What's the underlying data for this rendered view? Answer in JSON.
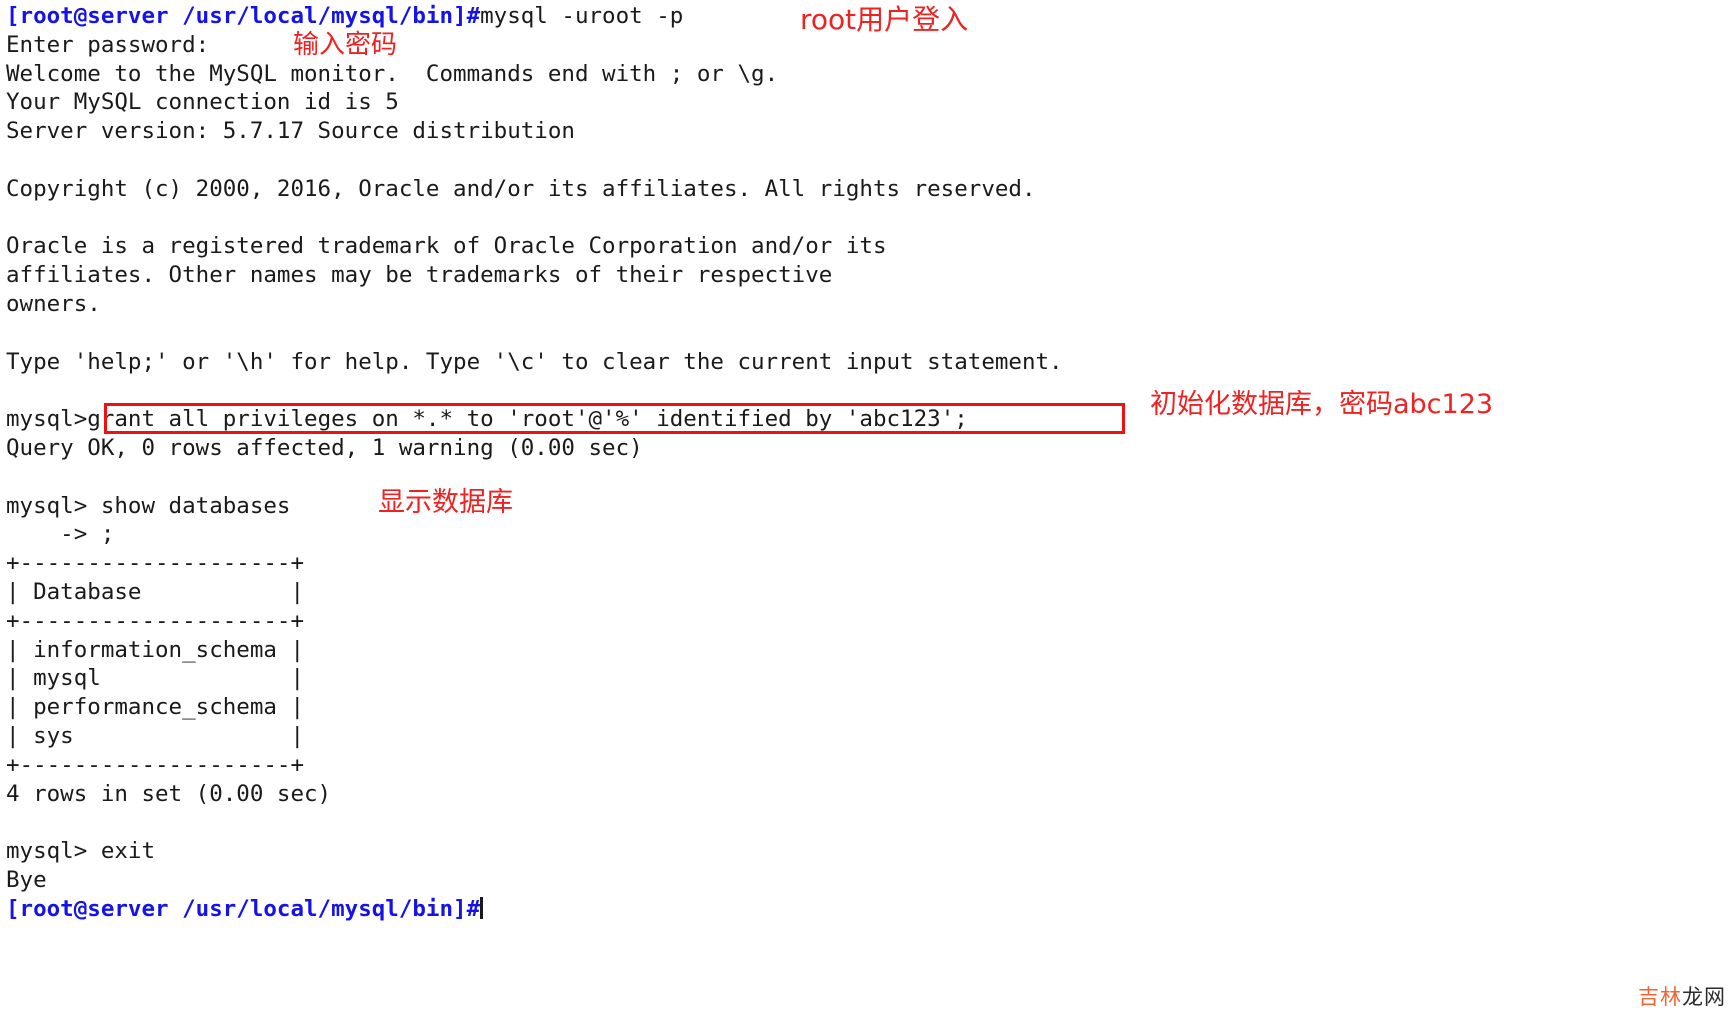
{
  "terminal": {
    "prompt": "[root@server /usr/local/mysql/bin]#",
    "lines": [
      {
        "id": "cmd-mysql-login",
        "type": "prompt",
        "prompt": "[root@server /usr/local/mysql/bin]#",
        "text": "mysql -uroot -p"
      },
      {
        "id": "enter-password",
        "type": "out",
        "text": "Enter password:"
      },
      {
        "id": "welcome",
        "type": "out",
        "text": "Welcome to the MySQL monitor.  Commands end with ; or \\g."
      },
      {
        "id": "connection-id",
        "type": "out",
        "text": "Your MySQL connection id is 5"
      },
      {
        "id": "server-version",
        "type": "out",
        "text": "Server version: 5.7.17 Source distribution"
      },
      {
        "id": "blank-1",
        "type": "blank",
        "text": ""
      },
      {
        "id": "copyright",
        "type": "out",
        "text": "Copyright (c) 2000, 2016, Oracle and/or its affiliates. All rights reserved."
      },
      {
        "id": "blank-2",
        "type": "blank",
        "text": ""
      },
      {
        "id": "trademark-1",
        "type": "out",
        "text": "Oracle is a registered trademark of Oracle Corporation and/or its"
      },
      {
        "id": "trademark-2",
        "type": "out",
        "text": "affiliates. Other names may be trademarks of their respective"
      },
      {
        "id": "trademark-3",
        "type": "out",
        "text": "owners."
      },
      {
        "id": "blank-3",
        "type": "blank",
        "text": ""
      },
      {
        "id": "help-hint",
        "type": "out",
        "text": "Type 'help;' or '\\h' for help. Type '\\c' to clear the current input statement."
      },
      {
        "id": "blank-4",
        "type": "blank",
        "text": ""
      },
      {
        "id": "cmd-grant",
        "type": "mysql",
        "prompt": "mysql>",
        "text": "grant all privileges on *.* to 'root'@'%' identified by 'abc123';"
      },
      {
        "id": "grant-result",
        "type": "out",
        "text": "Query OK, 0 rows affected, 1 warning (0.00 sec)"
      },
      {
        "id": "blank-5",
        "type": "blank",
        "text": ""
      },
      {
        "id": "cmd-show-databases",
        "type": "mysql",
        "prompt": "mysql>",
        "text": " show databases"
      },
      {
        "id": "continuation",
        "type": "out",
        "text": "    -> ;"
      },
      {
        "id": "tbl-top",
        "type": "out",
        "text": "+--------------------+"
      },
      {
        "id": "tbl-header",
        "type": "out",
        "text": "| Database           |"
      },
      {
        "id": "tbl-sep",
        "type": "out",
        "text": "+--------------------+"
      },
      {
        "id": "tbl-row-1",
        "type": "out",
        "text": "| information_schema |"
      },
      {
        "id": "tbl-row-2",
        "type": "out",
        "text": "| mysql              |"
      },
      {
        "id": "tbl-row-3",
        "type": "out",
        "text": "| performance_schema |"
      },
      {
        "id": "tbl-row-4",
        "type": "out",
        "text": "| sys                |"
      },
      {
        "id": "tbl-bottom",
        "type": "out",
        "text": "+--------------------+"
      },
      {
        "id": "rows-in-set",
        "type": "out",
        "text": "4 rows in set (0.00 sec)"
      },
      {
        "id": "blank-6",
        "type": "blank",
        "text": ""
      },
      {
        "id": "cmd-exit",
        "type": "mysql",
        "prompt": "mysql>",
        "text": " exit"
      },
      {
        "id": "bye",
        "type": "out",
        "text": "Bye"
      },
      {
        "id": "final-prompt",
        "type": "prompt-cursor",
        "prompt": "[root@server /usr/local/mysql/bin]#",
        "text": ""
      }
    ],
    "table": {
      "header": "Database",
      "rows": [
        "information_schema",
        "mysql",
        "performance_schema",
        "sys"
      ],
      "row_count_text": "4 rows in set (0.00 sec)"
    }
  },
  "annotations": {
    "login": "root用户登入",
    "password": "输入密码",
    "init_db": "初始化数据库，密码abc123",
    "show_db": "显示数据库",
    "color": "#ef2222"
  },
  "highlight": {
    "target_line": "grant all privileges on *.* to 'root'@'%' identified by 'abc123';",
    "box_color": "#ee1111"
  },
  "watermark": {
    "part_a": "吉林",
    "part_b": "龙网",
    "color_a": "#f06432",
    "color_b": "#2b2b2b"
  }
}
